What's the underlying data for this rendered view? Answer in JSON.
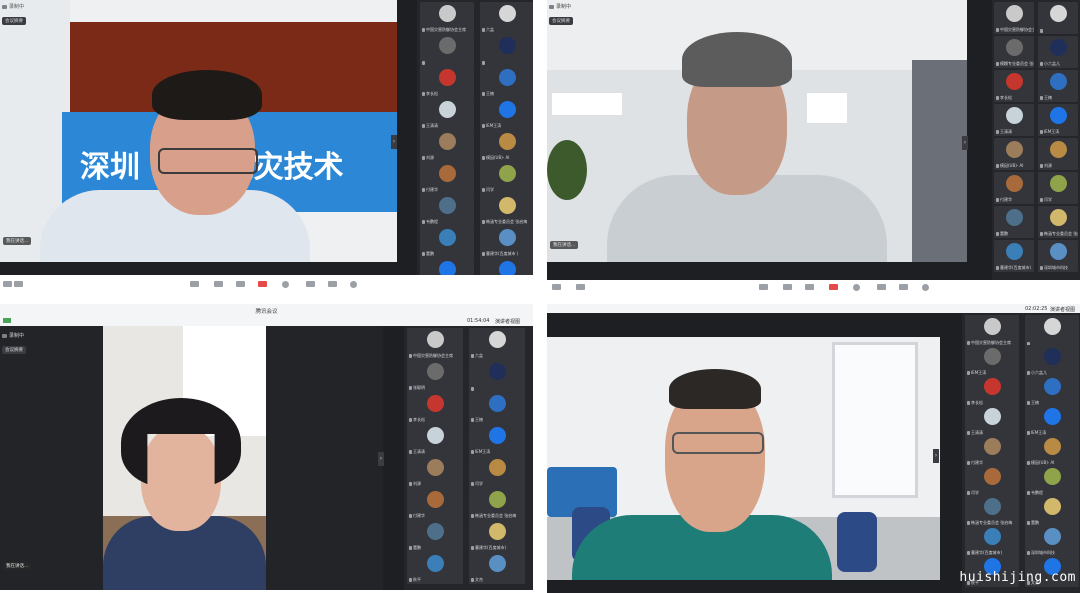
{
  "recording_label": "录制中",
  "minimize_label": "会议摘要",
  "talking_label": "我在讲话...",
  "speaking_prefix": "正在讲话:",
  "window_title": "腾讯会议",
  "timer_q3": "01:54:04",
  "timer_q4": "02:02:25",
  "view_label": "演讲者视图",
  "banner_text": "深圳        减灾技术",
  "watermark": "huishijing.com",
  "q1": {
    "speaker_tile_name": "深圳",
    "speaking": "深圳职业技术学院",
    "participants": [
      "中国灾害防御协会主席",
      "六盆",
      "",
      "",
      "李长松",
      "王楠",
      "王清清",
      "IEM王涛",
      "刘源",
      "模因(UB)- AI",
      "付建华",
      "闫学",
      "韦鹏程",
      "韩涵专业委员会 张启梅",
      "董鹏",
      "曹建华(百度城市 )",
      "秋平",
      "文杰"
    ]
  },
  "q2": {
    "participants": [
      "中国灾害防御协会主席",
      "",
      "模糊专业委员会 张涛",
      "小六盆儿",
      "李长松",
      "王楠",
      "王清清",
      "IEM王涛",
      "模因(UB)- AI",
      "刘源",
      "付建华",
      "闫学",
      "董鹏",
      "韩涵专业委员会 张启梅",
      "曹建华(百度城市)",
      "深圳城市科技"
    ]
  },
  "q3": {
    "speaking": "正在讲话: 张聪明",
    "participants": [
      "中国灾害防御协会主席",
      "六盆",
      "张聪明",
      "",
      "李长松",
      "王楠",
      "王清清",
      "IEM王涛",
      "刘源",
      "闫学",
      "付建华",
      "韩涵专业委员会 张启梅",
      "董鹏",
      "曹建华(百度城市)",
      "秋平",
      "文杰"
    ]
  },
  "q4": {
    "speaking": "正在讲话: IEM王涛",
    "participants": [
      "中国灾害防御协会主席",
      "",
      "IEM王涛",
      "小六盆儿",
      "李长松",
      "王楠",
      "王清清",
      "IEM王涛",
      "付建华",
      "模因(UB)- AI",
      "闫学",
      "韦鹏程",
      "韩涵专业委员会 张启梅",
      "董鹏",
      "曹建华(百度城市)",
      "深圳城市科技",
      "秋平",
      "文杰"
    ]
  },
  "colors": {
    "panel": "#1e1f22",
    "sidebar": "#25262a",
    "tile": "#33353a",
    "accent_blue": "#1f74e6",
    "mute_red": "#e54b4b",
    "orange_badge": "#f28c28"
  }
}
